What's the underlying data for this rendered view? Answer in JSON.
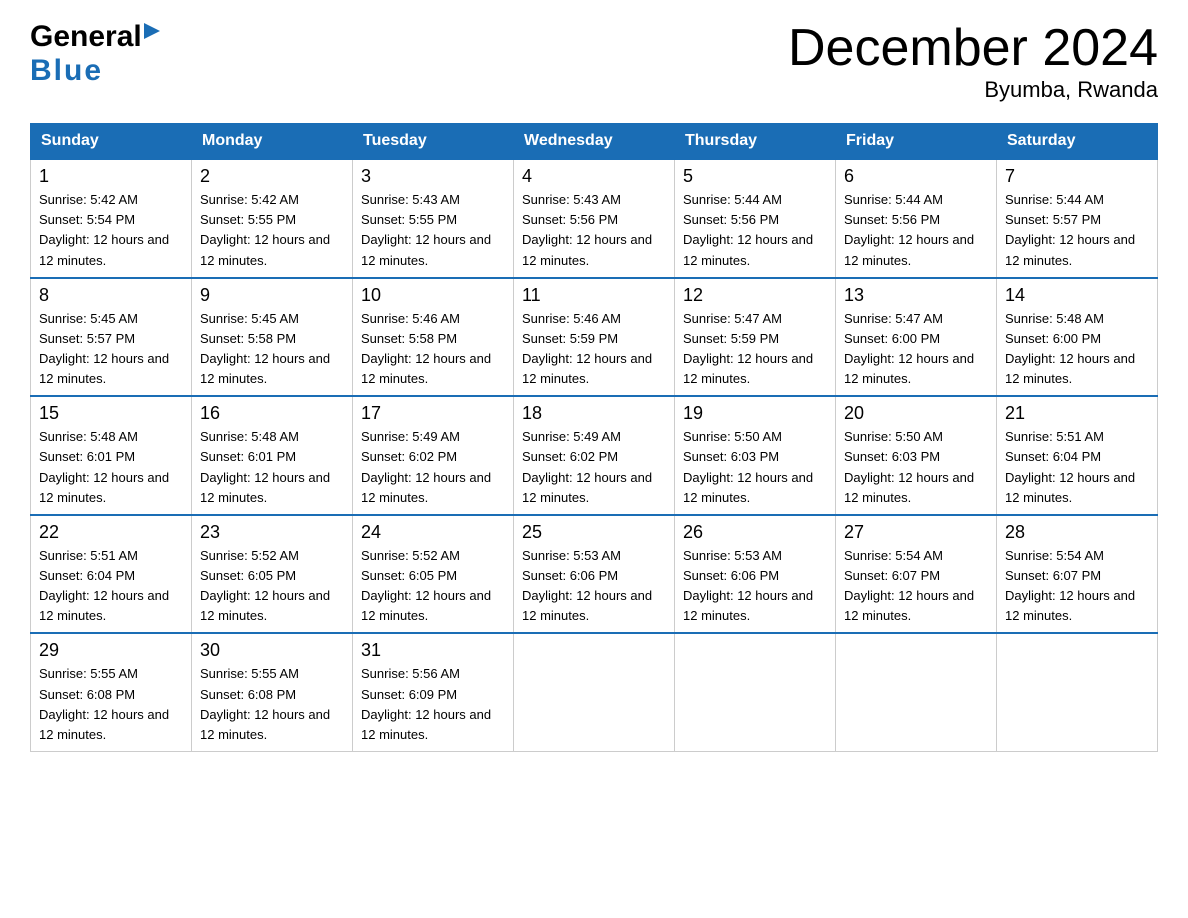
{
  "header": {
    "logo_general": "General",
    "logo_blue": "Blue",
    "month_title": "December 2024",
    "location": "Byumba, Rwanda"
  },
  "days_of_week": [
    "Sunday",
    "Monday",
    "Tuesday",
    "Wednesday",
    "Thursday",
    "Friday",
    "Saturday"
  ],
  "weeks": [
    [
      {
        "day": "1",
        "sunrise": "Sunrise: 5:42 AM",
        "sunset": "Sunset: 5:54 PM",
        "daylight": "Daylight: 12 hours and 12 minutes."
      },
      {
        "day": "2",
        "sunrise": "Sunrise: 5:42 AM",
        "sunset": "Sunset: 5:55 PM",
        "daylight": "Daylight: 12 hours and 12 minutes."
      },
      {
        "day": "3",
        "sunrise": "Sunrise: 5:43 AM",
        "sunset": "Sunset: 5:55 PM",
        "daylight": "Daylight: 12 hours and 12 minutes."
      },
      {
        "day": "4",
        "sunrise": "Sunrise: 5:43 AM",
        "sunset": "Sunset: 5:56 PM",
        "daylight": "Daylight: 12 hours and 12 minutes."
      },
      {
        "day": "5",
        "sunrise": "Sunrise: 5:44 AM",
        "sunset": "Sunset: 5:56 PM",
        "daylight": "Daylight: 12 hours and 12 minutes."
      },
      {
        "day": "6",
        "sunrise": "Sunrise: 5:44 AM",
        "sunset": "Sunset: 5:56 PM",
        "daylight": "Daylight: 12 hours and 12 minutes."
      },
      {
        "day": "7",
        "sunrise": "Sunrise: 5:44 AM",
        "sunset": "Sunset: 5:57 PM",
        "daylight": "Daylight: 12 hours and 12 minutes."
      }
    ],
    [
      {
        "day": "8",
        "sunrise": "Sunrise: 5:45 AM",
        "sunset": "Sunset: 5:57 PM",
        "daylight": "Daylight: 12 hours and 12 minutes."
      },
      {
        "day": "9",
        "sunrise": "Sunrise: 5:45 AM",
        "sunset": "Sunset: 5:58 PM",
        "daylight": "Daylight: 12 hours and 12 minutes."
      },
      {
        "day": "10",
        "sunrise": "Sunrise: 5:46 AM",
        "sunset": "Sunset: 5:58 PM",
        "daylight": "Daylight: 12 hours and 12 minutes."
      },
      {
        "day": "11",
        "sunrise": "Sunrise: 5:46 AM",
        "sunset": "Sunset: 5:59 PM",
        "daylight": "Daylight: 12 hours and 12 minutes."
      },
      {
        "day": "12",
        "sunrise": "Sunrise: 5:47 AM",
        "sunset": "Sunset: 5:59 PM",
        "daylight": "Daylight: 12 hours and 12 minutes."
      },
      {
        "day": "13",
        "sunrise": "Sunrise: 5:47 AM",
        "sunset": "Sunset: 6:00 PM",
        "daylight": "Daylight: 12 hours and 12 minutes."
      },
      {
        "day": "14",
        "sunrise": "Sunrise: 5:48 AM",
        "sunset": "Sunset: 6:00 PM",
        "daylight": "Daylight: 12 hours and 12 minutes."
      }
    ],
    [
      {
        "day": "15",
        "sunrise": "Sunrise: 5:48 AM",
        "sunset": "Sunset: 6:01 PM",
        "daylight": "Daylight: 12 hours and 12 minutes."
      },
      {
        "day": "16",
        "sunrise": "Sunrise: 5:48 AM",
        "sunset": "Sunset: 6:01 PM",
        "daylight": "Daylight: 12 hours and 12 minutes."
      },
      {
        "day": "17",
        "sunrise": "Sunrise: 5:49 AM",
        "sunset": "Sunset: 6:02 PM",
        "daylight": "Daylight: 12 hours and 12 minutes."
      },
      {
        "day": "18",
        "sunrise": "Sunrise: 5:49 AM",
        "sunset": "Sunset: 6:02 PM",
        "daylight": "Daylight: 12 hours and 12 minutes."
      },
      {
        "day": "19",
        "sunrise": "Sunrise: 5:50 AM",
        "sunset": "Sunset: 6:03 PM",
        "daylight": "Daylight: 12 hours and 12 minutes."
      },
      {
        "day": "20",
        "sunrise": "Sunrise: 5:50 AM",
        "sunset": "Sunset: 6:03 PM",
        "daylight": "Daylight: 12 hours and 12 minutes."
      },
      {
        "day": "21",
        "sunrise": "Sunrise: 5:51 AM",
        "sunset": "Sunset: 6:04 PM",
        "daylight": "Daylight: 12 hours and 12 minutes."
      }
    ],
    [
      {
        "day": "22",
        "sunrise": "Sunrise: 5:51 AM",
        "sunset": "Sunset: 6:04 PM",
        "daylight": "Daylight: 12 hours and 12 minutes."
      },
      {
        "day": "23",
        "sunrise": "Sunrise: 5:52 AM",
        "sunset": "Sunset: 6:05 PM",
        "daylight": "Daylight: 12 hours and 12 minutes."
      },
      {
        "day": "24",
        "sunrise": "Sunrise: 5:52 AM",
        "sunset": "Sunset: 6:05 PM",
        "daylight": "Daylight: 12 hours and 12 minutes."
      },
      {
        "day": "25",
        "sunrise": "Sunrise: 5:53 AM",
        "sunset": "Sunset: 6:06 PM",
        "daylight": "Daylight: 12 hours and 12 minutes."
      },
      {
        "day": "26",
        "sunrise": "Sunrise: 5:53 AM",
        "sunset": "Sunset: 6:06 PM",
        "daylight": "Daylight: 12 hours and 12 minutes."
      },
      {
        "day": "27",
        "sunrise": "Sunrise: 5:54 AM",
        "sunset": "Sunset: 6:07 PM",
        "daylight": "Daylight: 12 hours and 12 minutes."
      },
      {
        "day": "28",
        "sunrise": "Sunrise: 5:54 AM",
        "sunset": "Sunset: 6:07 PM",
        "daylight": "Daylight: 12 hours and 12 minutes."
      }
    ],
    [
      {
        "day": "29",
        "sunrise": "Sunrise: 5:55 AM",
        "sunset": "Sunset: 6:08 PM",
        "daylight": "Daylight: 12 hours and 12 minutes."
      },
      {
        "day": "30",
        "sunrise": "Sunrise: 5:55 AM",
        "sunset": "Sunset: 6:08 PM",
        "daylight": "Daylight: 12 hours and 12 minutes."
      },
      {
        "day": "31",
        "sunrise": "Sunrise: 5:56 AM",
        "sunset": "Sunset: 6:09 PM",
        "daylight": "Daylight: 12 hours and 12 minutes."
      },
      null,
      null,
      null,
      null
    ]
  ]
}
